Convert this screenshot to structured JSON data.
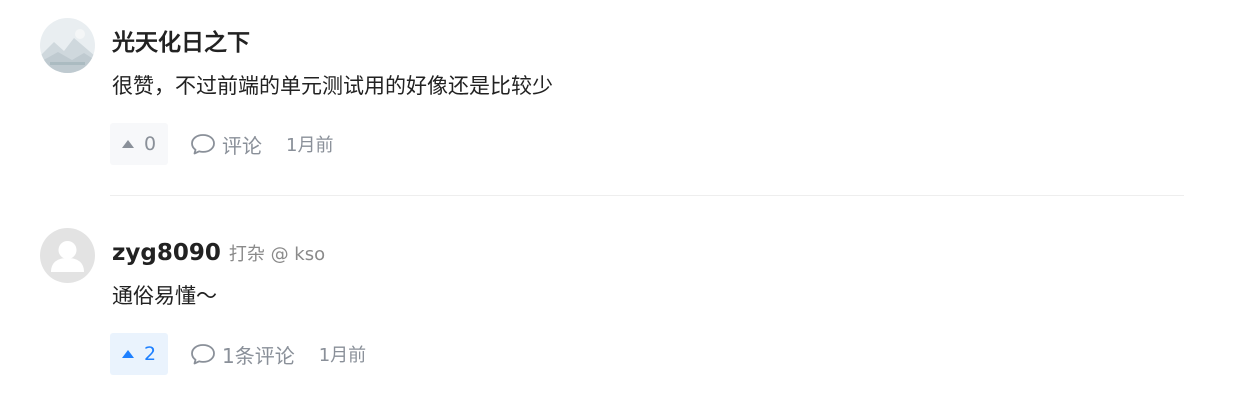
{
  "comments": [
    {
      "author": "光天化日之下",
      "author_meta": "",
      "content": "很赞，不过前端的单元测试用的好像还是比较少",
      "likes": "0",
      "liked": false,
      "comment_label": "评论",
      "time": "1月前",
      "avatar_icon": "landscape-avatar-icon"
    },
    {
      "author": "zyg8090",
      "author_meta": "打杂 @ kso",
      "content": "通俗易懂～",
      "likes": "2",
      "liked": true,
      "comment_label": "1条评论",
      "time": "1月前",
      "avatar_icon": "default-user-avatar-icon"
    }
  ],
  "colors": {
    "accent": "#1e80ff",
    "muted": "#8a9099",
    "divider": "#eeeeee"
  }
}
